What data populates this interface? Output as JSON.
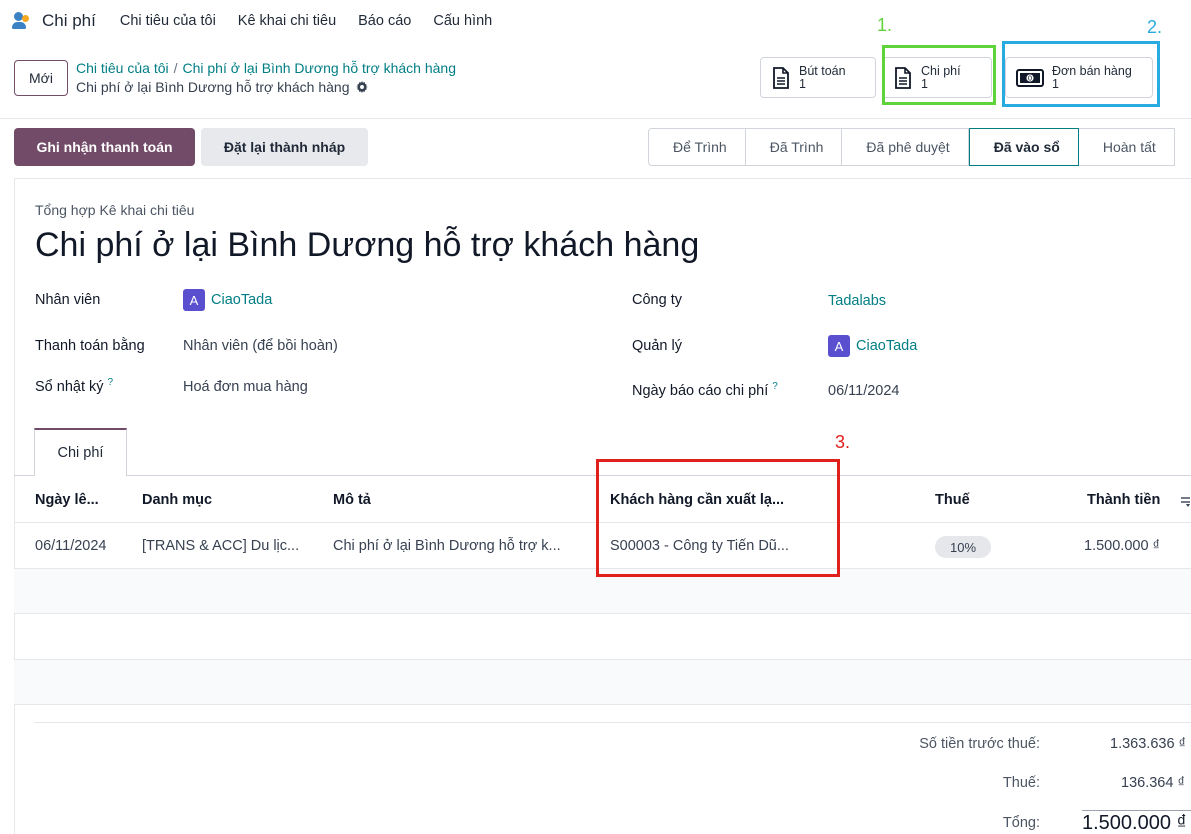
{
  "app": {
    "name": "Chi phí"
  },
  "nav": [
    "Chi tiêu của tôi",
    "Kê khai chi tiêu",
    "Báo cáo",
    "Cấu hình"
  ],
  "control": {
    "new_label": "Mới",
    "breadcrumb": [
      "Chi tiêu của tôi",
      "Chi phí ở lại Bình Dương hỗ trợ khách hàng"
    ],
    "current": "Chi phí ở lại Bình Dương hỗ trợ khách hàng"
  },
  "smart_buttons": [
    {
      "label": "Bút toán",
      "count": "1",
      "icon": "document-icon"
    },
    {
      "label": "Chi phí",
      "count": "1",
      "icon": "document-icon"
    },
    {
      "label": "Đơn bán hàng",
      "count": "1",
      "icon": "money-icon"
    }
  ],
  "annotations": {
    "one": "1.",
    "two": "2.",
    "three": "3."
  },
  "annotation_colors": {
    "green": "#5fd43a",
    "blue": "#29abe2",
    "red": "#e0201b"
  },
  "actions": {
    "register_payment": "Ghi nhận thanh toán",
    "reset_draft": "Đặt lại thành nháp"
  },
  "stages": [
    "Để Trình",
    "Đã Trình",
    "Đã phê duyệt",
    "Đã vào sổ",
    "Hoàn tất"
  ],
  "active_stage": "Đã vào sổ",
  "form": {
    "subtitle": "Tổng hợp Kê khai chi tiêu",
    "title": "Chi phí ở lại Bình Dương hỗ trợ khách hàng",
    "employee_label": "Nhân viên",
    "employee_avatar": "A",
    "employee_value": "CiaoTada",
    "paid_by_label": "Thanh toán bằng",
    "paid_by_value": "Nhân viên (để bồi hoàn)",
    "journal_label": "Sổ nhật ký",
    "journal_value": "Hoá đơn mua hàng",
    "company_label": "Công ty",
    "company_value": "Tadalabs",
    "manager_label": "Quản lý",
    "manager_avatar": "A",
    "manager_value": "CiaoTada",
    "date_label": "Ngày báo cáo chi phí",
    "date_value": "06/11/2024",
    "help_mark": "?"
  },
  "tab": {
    "label": "Chi phí"
  },
  "table": {
    "headers": [
      "Ngày lê...",
      "Danh mục",
      "Mô tả",
      "Khách hàng cần xuất lạ...",
      "Thuế",
      "Thành tiền"
    ],
    "row": [
      "06/11/2024",
      "[TRANS & ACC] Du lịc...",
      "Chi phí ở lại Bình Dương hỗ trợ k...",
      "S00003 - Công ty Tiến Dũ...",
      "10%",
      "1.500.000 ₫"
    ]
  },
  "summary": {
    "untaxed_label": "Số tiền trước thuế:",
    "untaxed_value": "1.363.636 ₫",
    "tax_label": "Thuế:",
    "tax_value": "136.364 ₫",
    "total_label": "Tổng:",
    "total_value": "1.500.000 ₫"
  }
}
